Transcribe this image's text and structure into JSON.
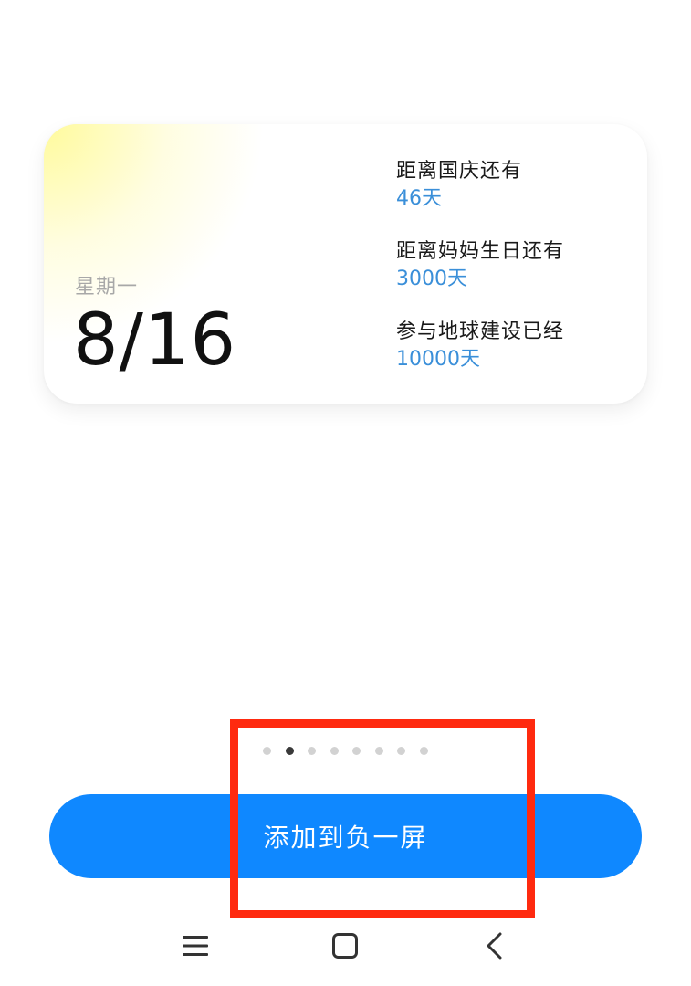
{
  "widget": {
    "weekday": "星期一",
    "date": "8/16",
    "events": [
      {
        "title": "距离国庆还有",
        "value": "46天"
      },
      {
        "title": "距离妈妈生日还有",
        "value": "3000天"
      },
      {
        "title": "参与地球建设已经",
        "value": "10000天"
      }
    ]
  },
  "pager": {
    "total": 8,
    "active_index": 1
  },
  "action": {
    "add_label": "添加到负一屏"
  },
  "navbar": {
    "menu_icon": "menu-icon",
    "home_icon": "home-icon",
    "back_icon": "back-icon"
  },
  "colors": {
    "accent": "#0f88ff",
    "value_blue": "#3a8fd9",
    "highlight": "#ff2a0f"
  }
}
